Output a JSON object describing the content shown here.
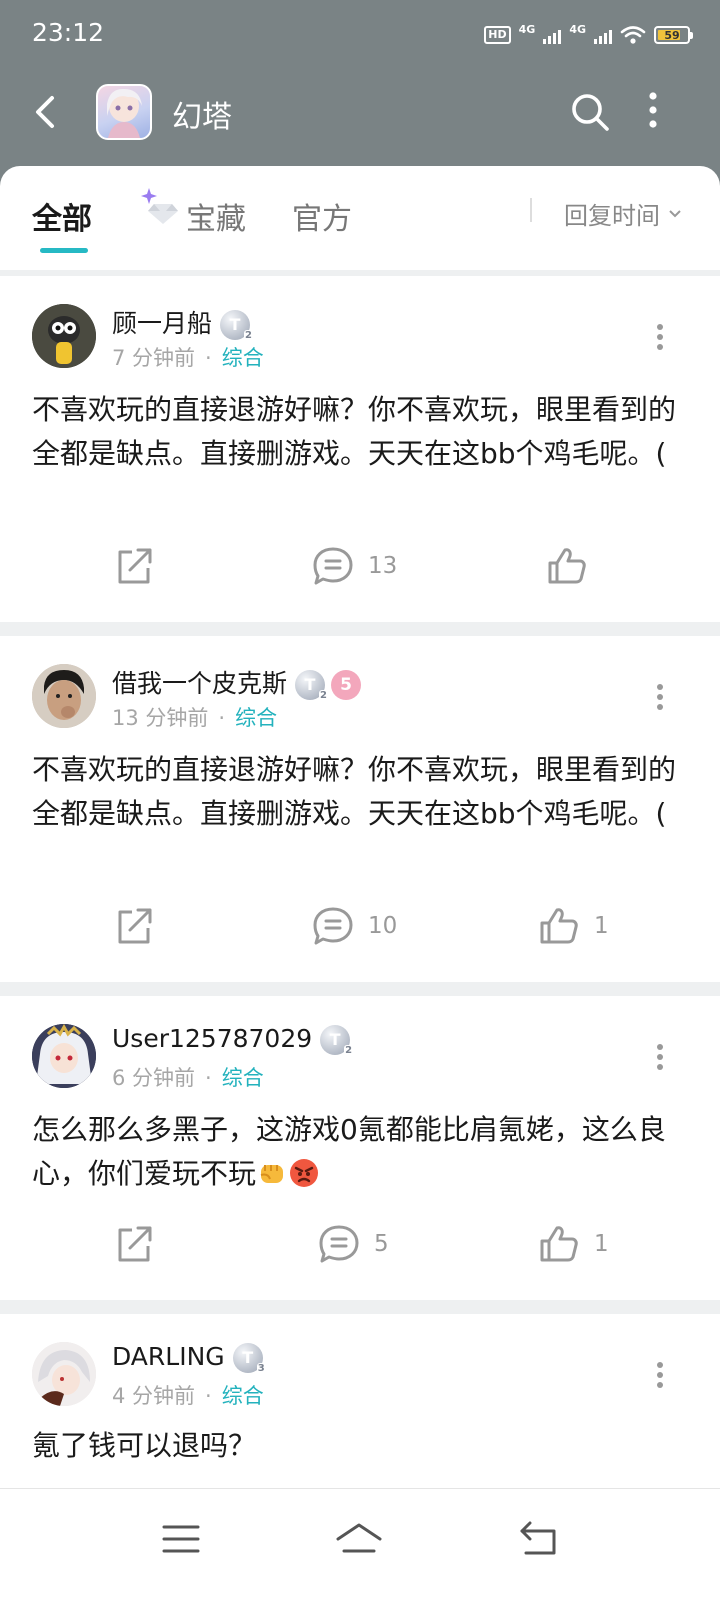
{
  "status_bar": {
    "time": "23:12",
    "hd_label": "HD",
    "network_1": "4G",
    "network_2": "4G",
    "battery": "59"
  },
  "header": {
    "app_name": "幻塔"
  },
  "tabs": {
    "items": [
      "全部",
      "宝藏",
      "官方"
    ],
    "active_index": 0,
    "sort_label": "回复时间",
    "accent_color": "#26b9c4"
  },
  "posts": [
    {
      "username": "顾一月船",
      "level": "T",
      "level_num": "2",
      "time": "7 分钟前",
      "category": "综合",
      "content": "不喜欢玩的直接退游好嘛？你不喜欢玩，眼里看到的全都是缺点。直接删游戏。天天在这bb个鸡毛呢。(",
      "comment_count": "13",
      "like_count": ""
    },
    {
      "username": "借我一个皮克斯",
      "level": "T",
      "level_num": "2",
      "fan_badge": "5",
      "time": "13 分钟前",
      "category": "综合",
      "content": "不喜欢玩的直接退游好嘛？你不喜欢玩，眼里看到的全都是缺点。直接删游戏。天天在这bb个鸡毛呢。(",
      "comment_count": "10",
      "like_count": "1"
    },
    {
      "username": "User125787029",
      "level": "T",
      "level_num": "2",
      "time": "6 分钟前",
      "category": "综合",
      "content": "怎么那么多黑子，这游戏0氪都能比肩氪姥，这么良心，你们爱玩不玩",
      "comment_count": "5",
      "like_count": "1"
    },
    {
      "username": "DARLING",
      "level": "T",
      "level_num": "3",
      "time": "4 分钟前",
      "category": "综合",
      "content": "氪了钱可以退吗？"
    }
  ],
  "meta_separator": "·",
  "icons": [
    "back-icon",
    "search-icon",
    "more-icon",
    "share-icon",
    "comment-icon",
    "like-icon",
    "menu-icon",
    "home-icon",
    "return-icon"
  ]
}
